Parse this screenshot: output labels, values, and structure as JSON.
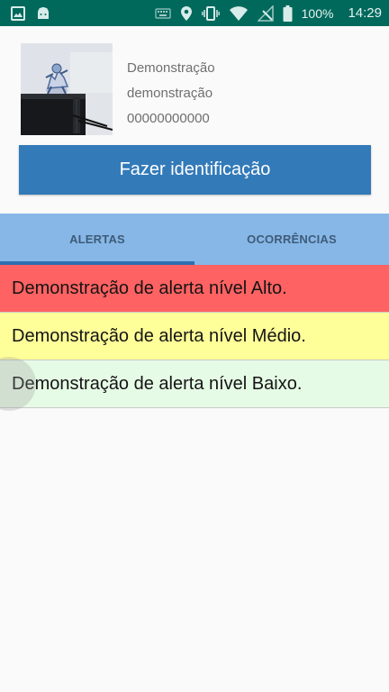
{
  "status_bar": {
    "battery_percent": "100%",
    "time": "14:29",
    "icons": [
      "image-icon",
      "android-icon",
      "keyboard-icon",
      "location-icon",
      "vibrate-icon",
      "wifi-icon",
      "no-signal-icon",
      "battery-icon"
    ]
  },
  "profile": {
    "name": "Demonstração",
    "username": "demonstração",
    "id_number": "00000000000",
    "identify_button_label": "Fazer identificação"
  },
  "tabs": [
    {
      "label": "ALERTAS",
      "active": true
    },
    {
      "label": "OCORRÊNCIAS",
      "active": false
    }
  ],
  "alerts": [
    {
      "text": "Demonstração de alerta nível Alto.",
      "color": "#ff6262"
    },
    {
      "text": "Demonstração de alerta nível Médio.",
      "color": "#ffff99"
    },
    {
      "text": "Demonstração de alerta nível Baixo.",
      "color": "#e6fbe6"
    }
  ],
  "colors": {
    "status_bar": "#00695c",
    "primary_button": "#337ab9",
    "tab_bar": "#86b7e7",
    "tab_indicator": "#2f6fb0"
  }
}
